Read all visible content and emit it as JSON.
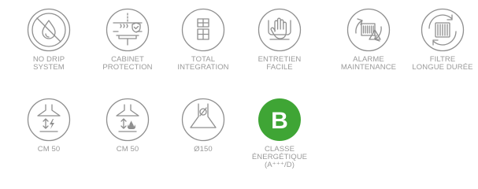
{
  "features": [
    {
      "icon": "no-drip-icon",
      "lines": [
        "NO DRIP",
        "SYSTEM"
      ]
    },
    {
      "icon": "cabinet-protection-icon",
      "lines": [
        "CABINET",
        "PROTECTION"
      ]
    },
    {
      "icon": "total-integration-icon",
      "lines": [
        "TOTAL",
        "INTEGRATION"
      ]
    },
    {
      "icon": "entretien-facile-icon",
      "lines": [
        "ENTRETIEN",
        "FACILE"
      ]
    },
    {
      "icon": "alarme-maintenance-icon",
      "lines": [
        "ALARME",
        "MAINTENANCE"
      ]
    },
    {
      "icon": "filtre-longue-duree-icon",
      "lines": [
        "FILTRE",
        "LONGUE DURÉE"
      ]
    },
    {
      "icon": "extraction-electric-icon",
      "lines": [
        "CM 50"
      ]
    },
    {
      "icon": "extraction-gas-icon",
      "lines": [
        "CM 50"
      ]
    },
    {
      "icon": "duct-diameter-icon",
      "lines": [
        "Ø150"
      ]
    },
    {
      "icon": "energy-class-badge",
      "badge_letter": "B",
      "badge_color": "#3fa535",
      "lines": [
        "CLASSE",
        "ÉNERGÉTIQUE",
        "(A⁺⁺⁺/D)"
      ]
    }
  ]
}
